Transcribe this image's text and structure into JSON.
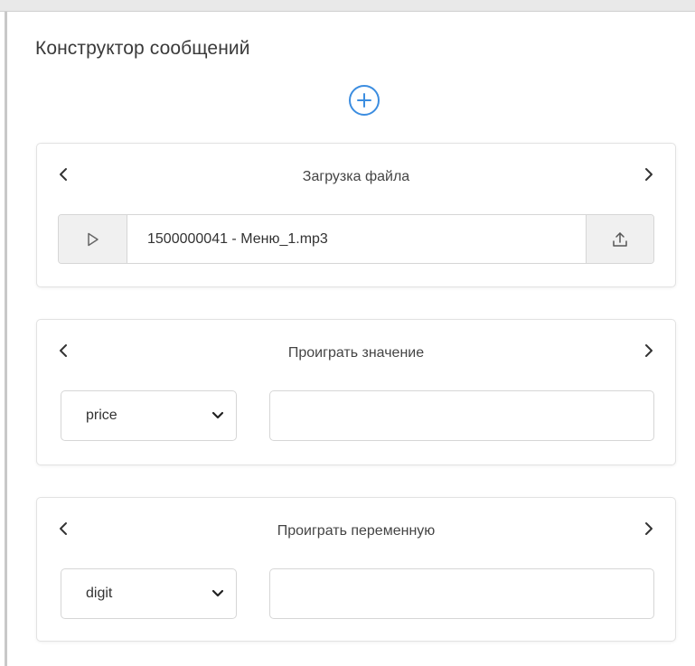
{
  "header": {
    "title": "Конструктор сообщений"
  },
  "toolbar": {
    "add_icon": "plus-circle-icon",
    "accent_color": "#3c8de0"
  },
  "cards": [
    {
      "title": "Загрузка файла",
      "file": {
        "name": "1500000041 - Меню_1.mp3",
        "play_icon": "play-icon",
        "upload_icon": "upload-icon"
      }
    },
    {
      "title": "Проиграть значение",
      "select": {
        "value": "price"
      },
      "input": {
        "value": "",
        "placeholder": ""
      }
    },
    {
      "title": "Проиграть переменную",
      "select": {
        "value": "digit"
      },
      "input": {
        "value": "",
        "placeholder": ""
      }
    }
  ]
}
